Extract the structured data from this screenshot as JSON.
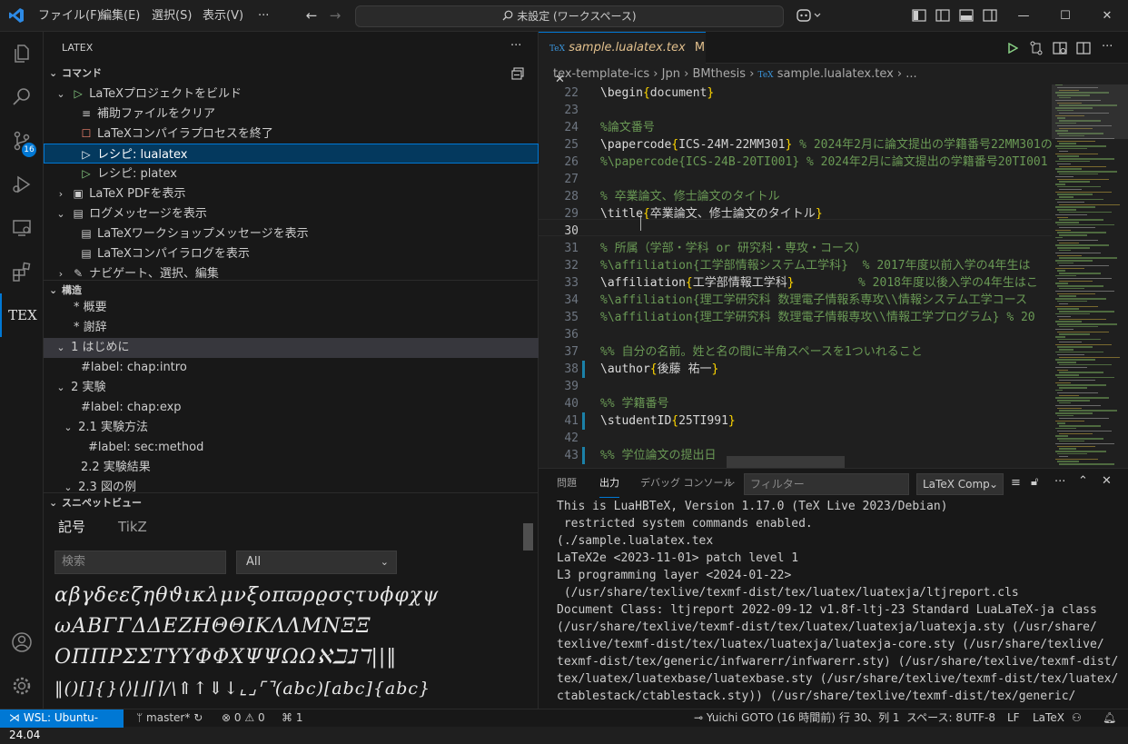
{
  "menu": {
    "file": "ファイル(F)",
    "edit": "編集(E)",
    "selection": "選択(S)",
    "view": "表示(V)",
    "more": "···"
  },
  "command_center": "未設定 (ワークスペース)",
  "activity": {
    "scm_badge": "16",
    "tex_label": "TEX"
  },
  "sidebar": {
    "title": "LATEX",
    "commands_header": "コマンド",
    "commands": [
      {
        "label": "LaTeXプロジェクトをビルド"
      },
      {
        "label": "補助ファイルをクリア"
      },
      {
        "label": "LaTeXコンパイラプロセスを終了"
      },
      {
        "label": "レシピ: lualatex"
      },
      {
        "label": "レシピ: platex"
      },
      {
        "label": "LaTeX PDFを表示"
      },
      {
        "label": "ログメッセージを表示"
      },
      {
        "label": "LaTeXワークショップメッセージを表示"
      },
      {
        "label": "LaTeXコンパイラログを表示"
      },
      {
        "label": "ナビゲート、選択、編集"
      }
    ],
    "structure_header": "構造",
    "structure": [
      {
        "label": "* 概要"
      },
      {
        "label": "* 謝辞"
      },
      {
        "label": "1 はじめに"
      },
      {
        "label": "#label: chap:intro"
      },
      {
        "label": "2 実験"
      },
      {
        "label": "#label: chap:exp"
      },
      {
        "label": "2.1 実験方法"
      },
      {
        "label": "#label: sec:method"
      },
      {
        "label": "2.2 実験結果"
      },
      {
        "label": "2.3 図の例"
      }
    ],
    "snippet_header": "スニペットビュー",
    "snippet_tabs": [
      "記号",
      "TikZ"
    ],
    "snippet_search_placeholder": "検索",
    "snippet_select": "All",
    "symbols": [
      "αβγδϵεζηθϑικλμνξοπϖρϱσςτυϕφχψ",
      "ωΑΒΓΓΔΔΕΖΗΘΘΙΚΛΛΜΝΞΞ",
      "ΟΠΠΡΣΣΤΥΥΦΦΧΨΨΩΩℵℶℷℸ||‖",
      "‖()[]{}⟨⟩⌊⌋⌈⌉/\\⇑↑⇓↓⌞⌟⌜⌝(abc)[abc]{abc}"
    ]
  },
  "editor": {
    "tab_label": "sample.lualatex.tex",
    "tab_modified": "M",
    "breadcrumb": [
      "tex-template-ics",
      "Jpn",
      "BMthesis",
      "sample.lualatex.tex",
      "..."
    ],
    "lines": [
      {
        "n": "22",
        "parts": [
          [
            "cmd",
            "\\begin"
          ],
          [
            "brace",
            "{"
          ],
          [
            "arg",
            "document"
          ],
          [
            "brace",
            "}"
          ]
        ]
      },
      {
        "n": "23",
        "parts": []
      },
      {
        "n": "24",
        "parts": [
          [
            "com",
            "%論文番号"
          ]
        ]
      },
      {
        "n": "25",
        "parts": [
          [
            "cmd",
            "\\papercode"
          ],
          [
            "brace",
            "{"
          ],
          [
            "arg",
            "ICS-24M-22MM301"
          ],
          [
            "brace",
            "}"
          ],
          [
            "com",
            " % 2024年2月に論文提出の学籍番号22MM301の"
          ]
        ]
      },
      {
        "n": "26",
        "parts": [
          [
            "com",
            "%\\papercode{ICS-24B-20TI001} % 2024年2月に論文提出の学籍番号20TI001"
          ]
        ]
      },
      {
        "n": "27",
        "parts": []
      },
      {
        "n": "28",
        "parts": [
          [
            "com",
            "% 卒業論文、修士論文のタイトル"
          ]
        ]
      },
      {
        "n": "29",
        "parts": [
          [
            "cmd",
            "\\title"
          ],
          [
            "brace",
            "{"
          ],
          [
            "arg",
            "卒業論文、修士論文のタイトル"
          ],
          [
            "brace",
            "}"
          ]
        ]
      },
      {
        "n": "30",
        "parts": []
      },
      {
        "n": "31",
        "parts": [
          [
            "com",
            "% 所属（学部・学科 or 研究科・専攻・コース）"
          ]
        ]
      },
      {
        "n": "32",
        "parts": [
          [
            "com",
            "%\\affiliation{工学部情報システム工学科}  % 2017年度以前入学の4年生は"
          ]
        ]
      },
      {
        "n": "33",
        "parts": [
          [
            "cmd",
            "\\affiliation"
          ],
          [
            "brace",
            "{"
          ],
          [
            "arg",
            "工学部情報工学科"
          ],
          [
            "brace",
            "}"
          ],
          [
            "com",
            "         % 2018年度以後入学の4年生はこ"
          ]
        ]
      },
      {
        "n": "34",
        "parts": [
          [
            "com",
            "%\\affiliation{理工学研究科 数理電子情報系専攻\\\\情報システム工学コース"
          ]
        ]
      },
      {
        "n": "35",
        "parts": [
          [
            "com",
            "%\\affiliation{理工学研究科 数理電子情報専攻\\\\情報工学プログラム} % 20"
          ]
        ]
      },
      {
        "n": "36",
        "parts": []
      },
      {
        "n": "37",
        "parts": [
          [
            "com",
            "%% 自分の名前。姓と名の間に半角スペースを1ついれること"
          ]
        ]
      },
      {
        "n": "38",
        "parts": [
          [
            "cmd",
            "\\author"
          ],
          [
            "brace",
            "{"
          ],
          [
            "arg",
            "後藤 祐一"
          ],
          [
            "brace",
            "}"
          ]
        ]
      },
      {
        "n": "39",
        "parts": []
      },
      {
        "n": "40",
        "parts": [
          [
            "com",
            "%% 学籍番号"
          ]
        ]
      },
      {
        "n": "41",
        "parts": [
          [
            "cmd",
            "\\studentID"
          ],
          [
            "brace",
            "{"
          ],
          [
            "arg",
            "25TI991"
          ],
          [
            "brace",
            "}"
          ]
        ]
      },
      {
        "n": "42",
        "parts": []
      },
      {
        "n": "43",
        "parts": [
          [
            "com",
            "%% 学位論文の提出日"
          ]
        ]
      }
    ]
  },
  "panel": {
    "tabs": [
      "問題",
      "出力",
      "デバッグ コンソール",
      "···"
    ],
    "filter_placeholder": "フィルター",
    "select": "LaTeX Comp",
    "output": [
      "This is LuaHBTeX, Version 1.17.0 (TeX Live 2023/Debian)",
      " restricted system commands enabled.",
      "(./sample.lualatex.tex",
      "LaTeX2e <2023-11-01> patch level 1",
      "L3 programming layer <2024-01-22>",
      " (/usr/share/texlive/texmf-dist/tex/luatex/luatexja/ltjreport.cls",
      "Document Class: ltjreport 2022-09-12 v1.8f-ltj-23 Standard LuaLaTeX-ja class",
      "(/usr/share/texlive/texmf-dist/tex/luatex/luatexja/luatexja.sty (/usr/share/",
      "texlive/texmf-dist/tex/luatex/luatexja/luatexja-core.sty (/usr/share/texlive/",
      "texmf-dist/tex/generic/infwarerr/infwarerr.sty) (/usr/share/texlive/texmf-dist/",
      "tex/luatex/luatexbase/luatexbase.sty (/usr/share/texlive/texmf-dist/tex/luatex/",
      "ctablestack/ctablestack.sty)) (/usr/share/texlive/texmf-dist/tex/generic/"
    ]
  },
  "status": {
    "remote": "WSL: Ubuntu-24.04",
    "branch": "master*",
    "errors": "0",
    "warnings": "0",
    "ports": "1",
    "blame": "Yuichi GOTO (16 時間前)",
    "position": "行 30、列 1",
    "spaces": "スペース: 8",
    "encoding": "UTF-8",
    "eol": "LF",
    "language": "LaTeX"
  }
}
